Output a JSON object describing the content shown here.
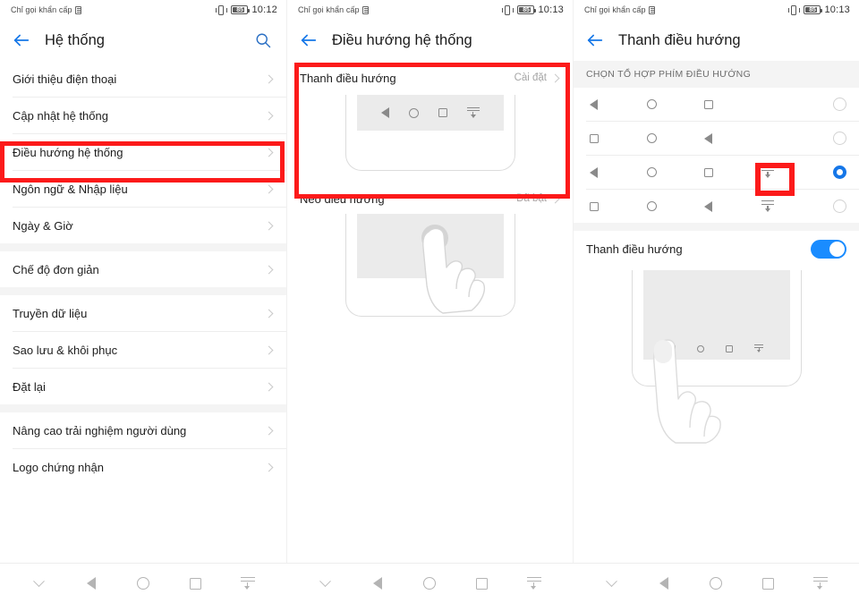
{
  "status_bar": {
    "carrier_text": "Chỉ gọi khẩn cấp",
    "battery_level": "85",
    "time_panel1": "10:12",
    "time_panel2": "10:13",
    "time_panel3": "10:13",
    "sim_icon": "sim-card-icon",
    "vibrate_icon": "vibrate-icon",
    "battery_icon": "battery-icon"
  },
  "panel1": {
    "title": "Hệ thống",
    "back_icon": "back-arrow-icon",
    "search_icon": "search-icon",
    "items": [
      {
        "label": "Giới thiệu điện thoại",
        "gap_after": false
      },
      {
        "label": "Cập nhật hệ thống",
        "gap_after": false
      },
      {
        "label": "Điều hướng hệ thống",
        "gap_after": false,
        "highlighted": true
      },
      {
        "label": "Ngôn ngữ & Nhập liệu",
        "gap_after": false
      },
      {
        "label": "Ngày & Giờ",
        "gap_after": true
      },
      {
        "label": "Chế độ đơn giản",
        "gap_after": true
      },
      {
        "label": "Truyền dữ liệu",
        "gap_after": false
      },
      {
        "label": "Sao lưu & khôi phục",
        "gap_after": false
      },
      {
        "label": "Đặt lại",
        "gap_after": true
      },
      {
        "label": "Nâng cao trải nghiệm người dùng",
        "gap_after": false
      },
      {
        "label": "Logo chứng nhận",
        "gap_after": false
      }
    ]
  },
  "panel2": {
    "title": "Điều hướng hệ thống",
    "back_icon": "back-arrow-icon",
    "card1": {
      "label": "Thanh điều hướng",
      "value": "Cài đặt",
      "highlighted": true,
      "preview_icons": [
        "back-triangle-icon",
        "home-circle-icon",
        "recents-square-icon",
        "hide-navbar-icon"
      ]
    },
    "card2": {
      "label": "Neo điều hướng",
      "value": "Đã bật",
      "highlighted": false,
      "illustration": "hand-tap-illustration"
    }
  },
  "panel3": {
    "title": "Thanh điều hướng",
    "back_icon": "back-arrow-icon",
    "section_header": "CHỌN TỔ HỢP PHÍM ĐIỀU HƯỚNG",
    "combos": [
      {
        "glyphs": [
          "back",
          "home",
          "recents"
        ],
        "selected": false
      },
      {
        "glyphs": [
          "recents",
          "home",
          "back"
        ],
        "selected": false
      },
      {
        "glyphs": [
          "back",
          "home",
          "recents",
          "hide"
        ],
        "selected": true,
        "highlight_glyph_index": 3
      },
      {
        "glyphs": [
          "recents",
          "home",
          "back",
          "hide"
        ],
        "selected": false
      }
    ],
    "toggle": {
      "label": "Thanh điều hướng",
      "state": "on"
    },
    "illustration": "hand-tap-navbar-illustration",
    "preview_icons": [
      "back-triangle-icon",
      "home-circle-icon",
      "recents-square-icon",
      "hide-navbar-icon"
    ]
  },
  "system_nav": {
    "buttons": [
      "chevron-down-icon",
      "back-triangle-icon",
      "home-circle-icon",
      "recents-square-icon",
      "hide-navbar-icon"
    ]
  },
  "colors": {
    "accent_blue": "#1677e8",
    "highlight_red": "#fc1a1a",
    "toggle_blue": "#1a8cff"
  }
}
